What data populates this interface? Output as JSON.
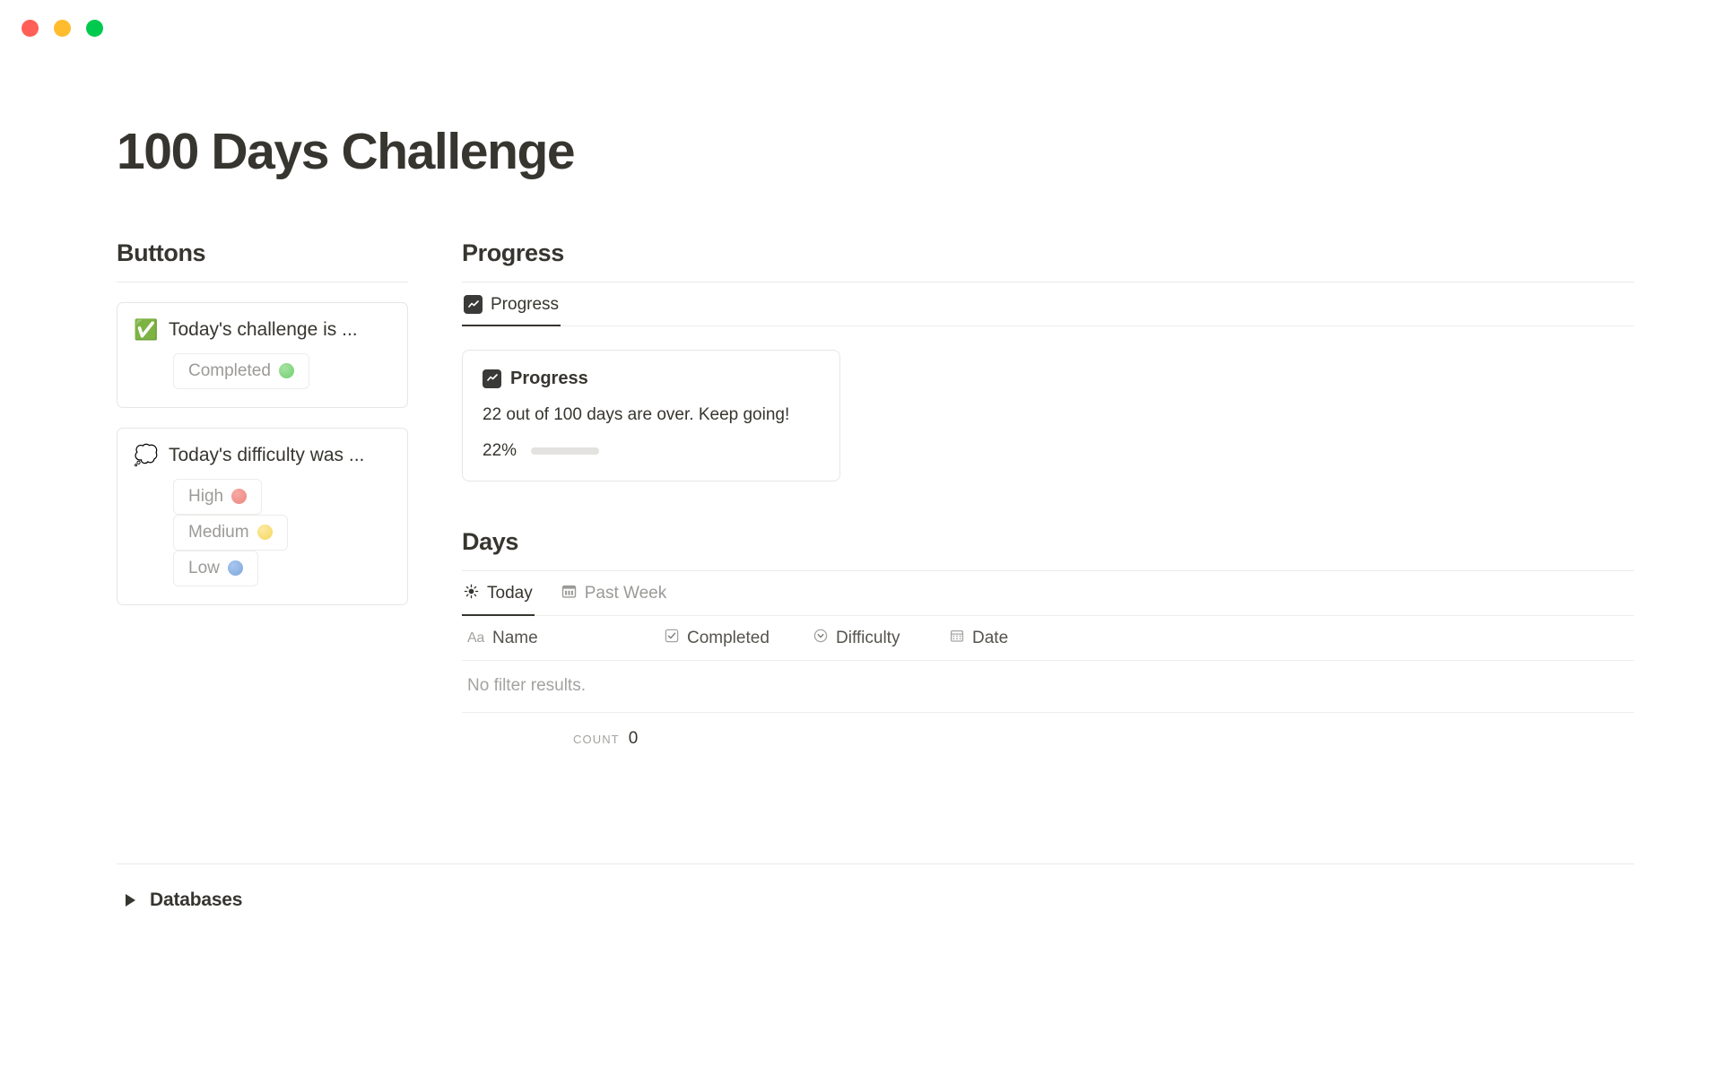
{
  "window": {
    "lights": [
      {
        "name": "close",
        "color": "#ff5f56"
      },
      {
        "name": "minimize",
        "color": "#ffbd2e"
      },
      {
        "name": "zoom",
        "color": "#00ca4e"
      }
    ]
  },
  "page": {
    "title": "100 Days Challenge"
  },
  "buttons_section": {
    "heading": "Buttons",
    "cards": [
      {
        "icon": "white-heavy-check-mark-emoji",
        "emoji": "✅",
        "label": "Today's challenge is ...",
        "actions": [
          {
            "label": "Completed",
            "emoji": "✅",
            "dot": "green",
            "name": "completed"
          }
        ]
      },
      {
        "icon": "thought-balloon-emoji",
        "emoji": "💭",
        "label": "Today's difficulty was ...",
        "actions": [
          {
            "label": "High",
            "emoji": "🔴",
            "dot": "red",
            "name": "high"
          },
          {
            "label": "Medium",
            "emoji": "🟡",
            "dot": "yellow",
            "name": "medium"
          },
          {
            "label": "Low",
            "emoji": "🔵",
            "dot": "blue",
            "name": "low"
          }
        ]
      }
    ]
  },
  "progress_section": {
    "heading": "Progress",
    "tabs": [
      {
        "label": "Progress",
        "icon": "line-chart-icon",
        "active": true
      }
    ],
    "card": {
      "icon": "line-chart-icon",
      "title": "Progress",
      "description": "22 out of 100 days are over. Keep going!",
      "percent_label": "22%",
      "percent_value": 22,
      "days_done": 22,
      "days_total": 100
    }
  },
  "days_section": {
    "heading": "Days",
    "tabs": [
      {
        "label": "Today",
        "icon": "sun-icon",
        "active": true
      },
      {
        "label": "Past Week",
        "icon": "calendar-icon",
        "active": false
      }
    ],
    "columns": [
      {
        "label": "Name",
        "icon": "text-property-icon",
        "type_glyph": "Aa"
      },
      {
        "label": "Completed",
        "icon": "checkbox-property-icon"
      },
      {
        "label": "Difficulty",
        "icon": "select-property-icon"
      },
      {
        "label": "Date",
        "icon": "date-property-icon"
      }
    ],
    "rows": [],
    "empty_text": "No filter results.",
    "count_label": "Count",
    "count_value": "0"
  },
  "footer": {
    "toggle_label": "Databases",
    "toggle_icon": "triangle-right-icon",
    "expanded": false
  },
  "colors": {
    "text_primary": "#37352f",
    "text_muted": "#9b9a97",
    "border": "#e6e6e4",
    "rule": "#e9e9e7",
    "bar_fill": "#787774",
    "bar_track": "#e3e2e0"
  }
}
